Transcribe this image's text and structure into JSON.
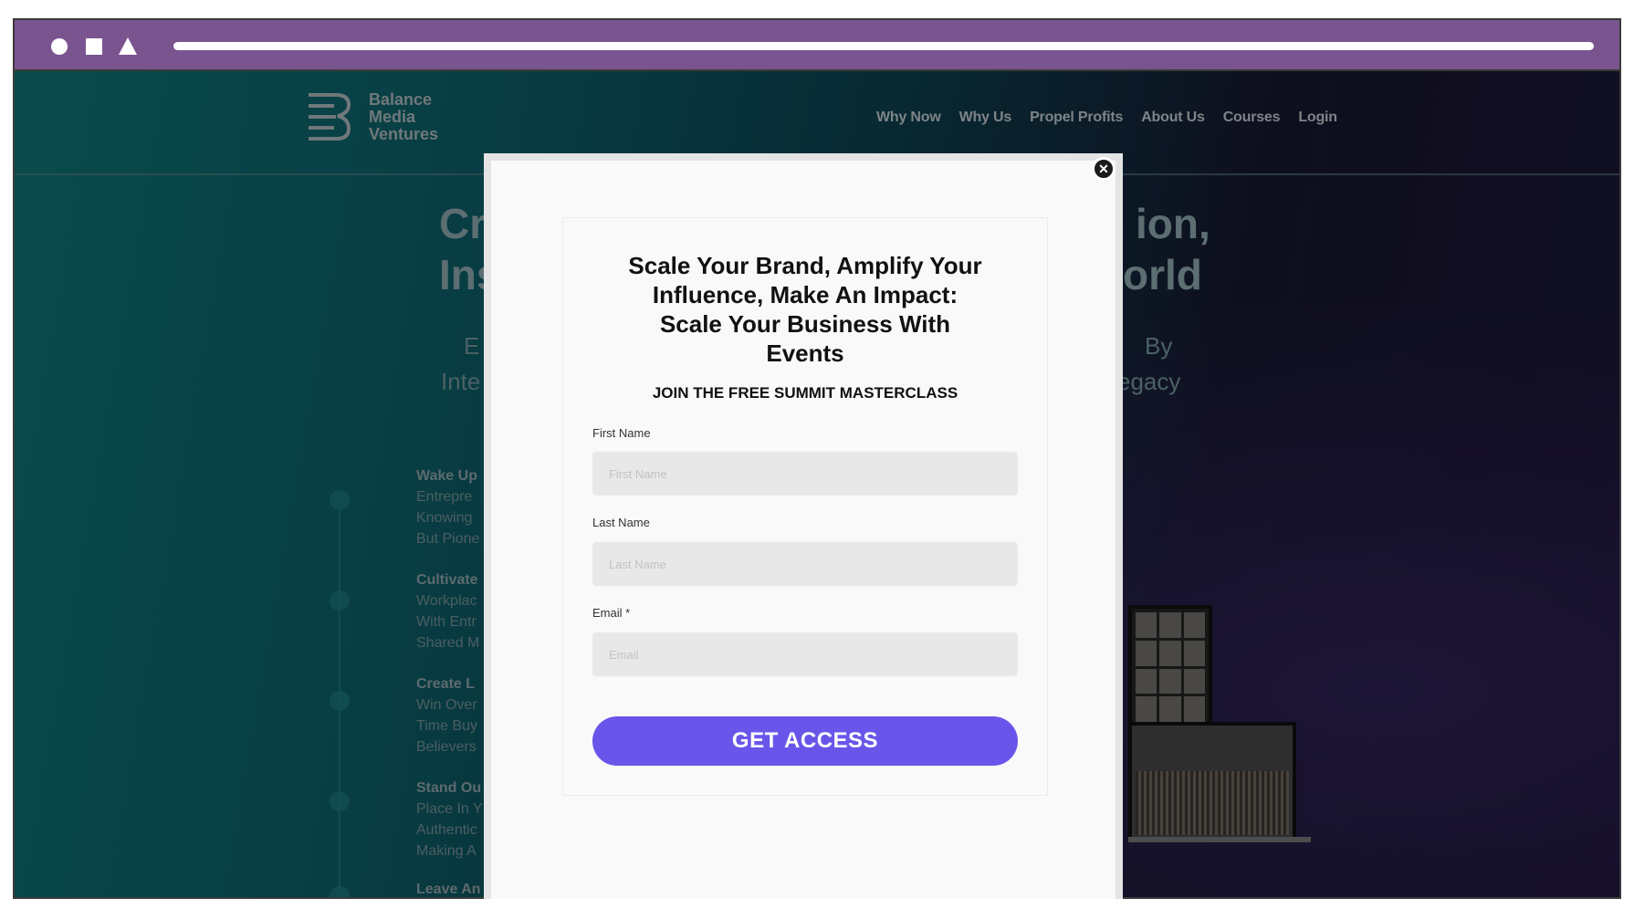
{
  "browser": {
    "chrome_color": "#7a548f"
  },
  "site": {
    "logo": {
      "line1": "Balance",
      "line2": "Media",
      "line3": "Ventures"
    },
    "nav": [
      "Why Now",
      "Why Us",
      "Propel Profits",
      "About Us",
      "Courses",
      "Login"
    ],
    "hero_left": {
      "line1": "Cr",
      "line2": "Ins"
    },
    "hero_right": {
      "line1": "ion,",
      "line2": "orld"
    },
    "sub_left": {
      "line1": "E",
      "line2": "Inte"
    },
    "sub_right": {
      "line1": "By",
      "line2": "egacy"
    },
    "timeline": [
      {
        "title": "Wake Up",
        "lines": [
          "Entrepre",
          "Knowing",
          "But Pione"
        ]
      },
      {
        "title": "Cultivate",
        "lines": [
          "Workplac",
          "With Entr",
          "Shared M"
        ]
      },
      {
        "title": "Create L",
        "lines": [
          "Win Over",
          "Time Buy",
          "Believers"
        ]
      },
      {
        "title": "Stand Ou",
        "lines": [
          "Place In Y",
          "Authentic",
          "Making A"
        ]
      },
      {
        "title": "Leave An",
        "lines": []
      }
    ]
  },
  "modal": {
    "close_icon": "✕",
    "title_lines": [
      "Scale Your Brand, Amplify Your",
      "Influence, Make An Impact:",
      "Scale Your Business With",
      "Events"
    ],
    "subtitle": "JOIN THE FREE SUMMIT MASTERCLASS",
    "fields": [
      {
        "label": "First Name",
        "placeholder": "First Name"
      },
      {
        "label": "Last Name",
        "placeholder": "Last Name"
      },
      {
        "label": "Email *",
        "placeholder": "Email"
      }
    ],
    "cta_label": "GET ACCESS",
    "cta_color": "#6a55ea"
  }
}
